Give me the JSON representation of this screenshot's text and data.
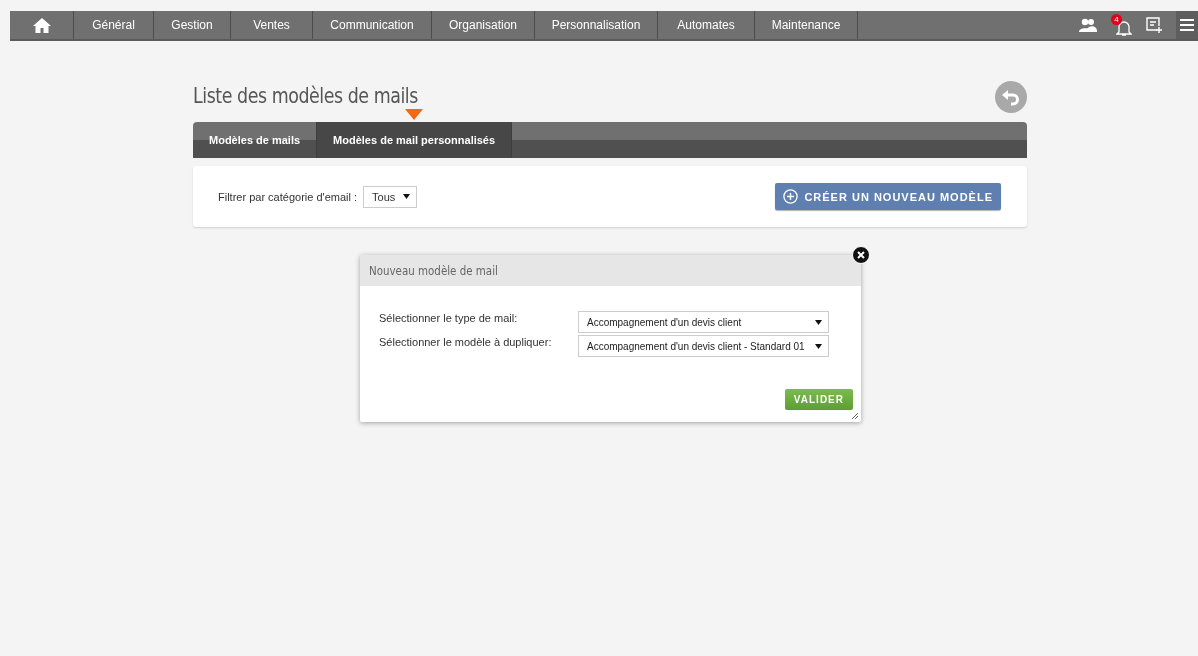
{
  "nav": {
    "items": [
      {
        "label": "Général"
      },
      {
        "label": "Gestion"
      },
      {
        "label": "Ventes"
      },
      {
        "label": "Communication"
      },
      {
        "label": "Organisation"
      },
      {
        "label": "Personnalisation"
      },
      {
        "label": "Automates"
      },
      {
        "label": "Maintenance"
      }
    ],
    "notifications": "4"
  },
  "page": {
    "title": "Liste des modèles de mails"
  },
  "tabs": [
    {
      "label": "Modèles de mails",
      "selected": false
    },
    {
      "label": "Modèles de mail personnalisés",
      "selected": true
    }
  ],
  "filter": {
    "label": "Filtrer par catégorie d'email :",
    "value": "Tous"
  },
  "create_button": "CRÉER UN NOUVEAU MODÈLE",
  "dialog": {
    "title": "Nouveau modèle de mail",
    "fields": [
      {
        "label": "Sélectionner le type de mail:",
        "value": "Accompagnement d'un devis client"
      },
      {
        "label": "Sélectionner le modèle à dupliquer:",
        "value": "Accompagnement d'un devis client - Standard 01"
      }
    ],
    "submit": "VALIDER"
  }
}
